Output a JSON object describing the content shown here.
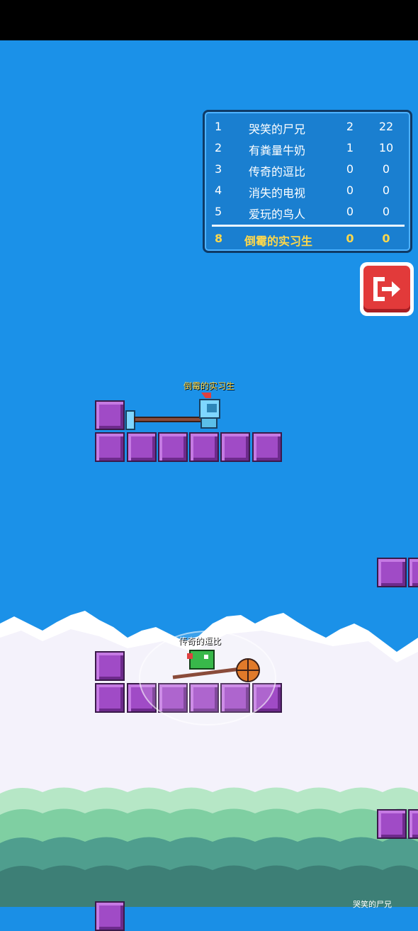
{
  "leaderboard": {
    "rows": [
      {
        "rank": "1",
        "name": "哭笑的尸兄",
        "kills": "2",
        "score": "22"
      },
      {
        "rank": "2",
        "name": "有粪量牛奶",
        "kills": "1",
        "score": "10"
      },
      {
        "rank": "3",
        "name": "传奇的逗比",
        "kills": "0",
        "score": "0"
      },
      {
        "rank": "4",
        "name": "消失的电视",
        "kills": "0",
        "score": "0"
      },
      {
        "rank": "5",
        "name": "爱玩的鸟人",
        "kills": "0",
        "score": "0"
      }
    ],
    "self": {
      "rank": "8",
      "name": "倒霉的实习生",
      "kills": "0",
      "score": "0"
    }
  },
  "players": {
    "self_name": "倒霉的实习生",
    "enemy_name": "传奇的逗比"
  },
  "bottom_text": "哭笑的尸兄",
  "colors": {
    "sky": "#1b91e8",
    "block": "#a04bc6",
    "highlight": "#ffd84a",
    "exit_button": "#e23a3a"
  },
  "icons": {
    "exit": "exit-door-arrow-icon"
  }
}
